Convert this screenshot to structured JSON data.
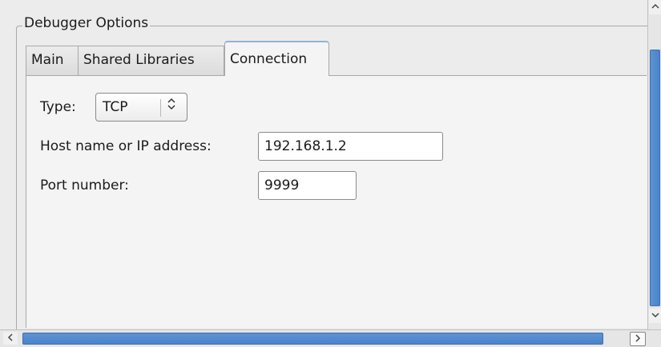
{
  "group": {
    "title": "Debugger Options"
  },
  "tabs": [
    {
      "label": "Main",
      "selected": false
    },
    {
      "label": "Shared Libraries",
      "selected": false
    },
    {
      "label": "Connection",
      "selected": true
    }
  ],
  "connection": {
    "type_label": "Type:",
    "type_value": "TCP",
    "host_label": "Host name or IP address:",
    "host_value": "192.168.1.2",
    "port_label": "Port number:",
    "port_value": "9999"
  },
  "icons": {
    "combo_arrows": "updown-chevron-icon",
    "scroll_up": "arrow-up-icon",
    "scroll_down": "arrow-down-icon",
    "scroll_left": "arrow-left-icon",
    "scroll_right": "arrow-right-icon"
  },
  "colors": {
    "scroll_thumb": "#4b83c9",
    "selected_tab_accent": "#8fb3d9"
  }
}
